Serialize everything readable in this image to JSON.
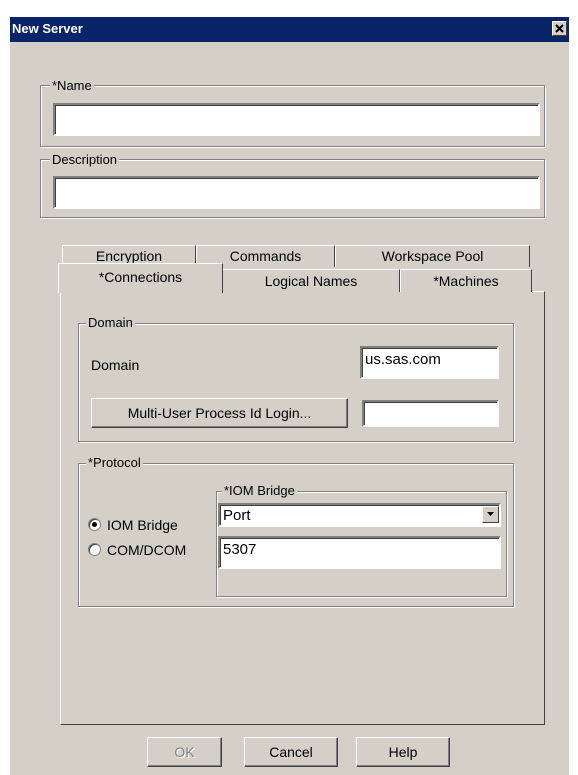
{
  "window": {
    "title": "New Server"
  },
  "name_field": {
    "label": "*Name",
    "value": ""
  },
  "description_field": {
    "label": "Description",
    "value": ""
  },
  "tabs": {
    "back_row": [
      "Encryption",
      "Commands",
      "Workspace Pool"
    ],
    "front_row": [
      "*Connections",
      "Logical Names",
      "*Machines"
    ],
    "active": "*Connections"
  },
  "domain_group": {
    "legend": "Domain",
    "domain_label": "Domain",
    "domain_value": "us.sas.com",
    "login_button": "Multi-User Process Id Login...",
    "login_value": ""
  },
  "protocol_group": {
    "legend": "*Protocol",
    "options": [
      "IOM Bridge",
      "COM/DCOM"
    ],
    "selected": "IOM Bridge",
    "iom_bridge": {
      "legend": "*IOM Bridge",
      "select_value": "Port",
      "port_value": "5307"
    }
  },
  "buttons": {
    "ok": "OK",
    "cancel": "Cancel",
    "help": "Help"
  },
  "colors": {
    "title_bar": "#0a246a",
    "face": "#d4d0c8"
  }
}
